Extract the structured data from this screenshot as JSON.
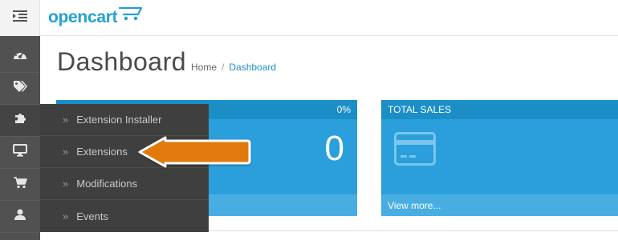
{
  "header": {
    "logo_text": "opencart"
  },
  "sidebar": {
    "items": [
      {
        "icon": "dashboard-gauge-icon"
      },
      {
        "icon": "tags-icon"
      },
      {
        "icon": "puzzle-piece-icon"
      },
      {
        "icon": "desktop-monitor-icon"
      },
      {
        "icon": "shopping-cart-icon"
      },
      {
        "icon": "user-icon"
      }
    ]
  },
  "page": {
    "title": "Dashboard",
    "breadcrumb": [
      "Home",
      "Dashboard"
    ],
    "breadcrumb_sep": "/"
  },
  "tiles": [
    {
      "title": "",
      "percent": "0%",
      "value": "0",
      "footer": ""
    },
    {
      "title": "TOTAL SALES",
      "percent": "",
      "value": "",
      "footer": "View more...",
      "icon": "credit-card-icon"
    }
  ],
  "flyout": {
    "items": [
      {
        "label": "Extension Installer"
      },
      {
        "label": "Extensions"
      },
      {
        "label": "Modifications"
      },
      {
        "label": "Events"
      }
    ]
  },
  "colors": {
    "brand_blue": "#23a1d1",
    "tile_blue": "#2b9fdb",
    "sidebar_bg": "#515151",
    "flyout_bg": "#3f3f3f",
    "annotation_arrow": "#e07a10"
  }
}
